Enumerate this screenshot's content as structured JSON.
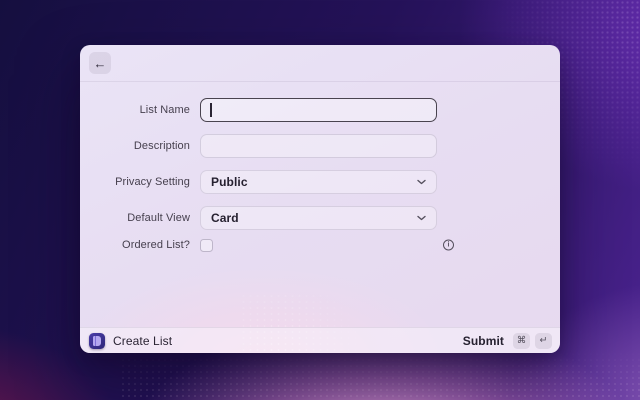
{
  "header": {
    "back_label": "←"
  },
  "form": {
    "fields": [
      {
        "label": "List Name",
        "type": "text",
        "value": "",
        "state": "focused"
      },
      {
        "label": "Description",
        "type": "text",
        "value": ""
      },
      {
        "label": "Privacy Setting",
        "type": "select",
        "value": "Public"
      },
      {
        "label": "Default View",
        "type": "select",
        "value": "Card"
      },
      {
        "label": "Ordered List?",
        "type": "checkbox",
        "checked": false
      }
    ],
    "info_icon_glyph": "i"
  },
  "footer": {
    "app_name": "Create List",
    "submit_label": "Submit",
    "shortcut_keys": [
      "⌘",
      "↵"
    ]
  },
  "colors": {
    "app_icon_bg": "#3a2f93",
    "focus_border": "#49434f",
    "wallpaper_top": "#150f3f",
    "wallpaper_accent_pink": "#e8a6db"
  }
}
